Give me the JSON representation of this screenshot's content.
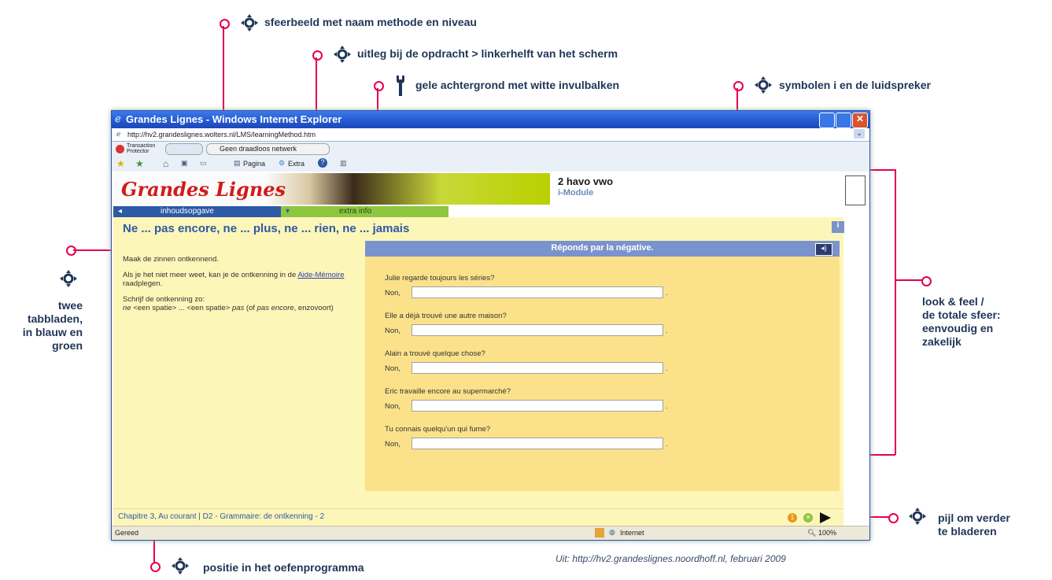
{
  "annotations": {
    "top1": "sfeerbeeld met naam methode en niveau",
    "top2": "uitleg bij de opdracht > linkerhelft van het scherm",
    "top3": "gele achtergrond met witte invulbalken",
    "top4": "symbolen i en de luidspreker",
    "left1": "twee",
    "left2": "tabbladen,",
    "left3": "in blauw en",
    "left4": "groen",
    "right1": "look & feel /",
    "right2": "de totale sfeer:",
    "right3": "eenvoudig en",
    "right4": "zakelijk",
    "arrow1": "pijl om verder",
    "arrow2": "te bladeren",
    "bottom": "positie in het oefenprogramma"
  },
  "caption": "Uit: http://hv2.grandeslignes.noordhoff.nl, februari 2009",
  "window": {
    "title": "Grandes Lignes - Windows Internet Explorer",
    "address": "http://hv2.grandeslignes.wolters.nl/LMS/learningMethod.htm",
    "transaction_protector": "Transaction Protector",
    "network": "Geen draadloos netwerk",
    "pagina": "Pagina",
    "extra": "Extra",
    "status_left": "Gereed",
    "zone": "Internet",
    "zoom": "100%"
  },
  "page": {
    "logo": "Grandes Lignes",
    "level": "2 havo vwo",
    "module": "i-Module",
    "tab_contents": "inhoudsopgave",
    "tab_extra": "extra info",
    "heading": "Ne ... pas encore, ne ... plus, ne ... rien, ne ... jamais",
    "info_icon": "i",
    "instructions": {
      "p1": "Maak de zinnen ontkennend.",
      "p2_pre": "Als je het niet meer weet, kan je de ontkenning in de ",
      "p2_link": "Aide-Mémoire",
      "p2_post": " raadplegen.",
      "p3_title": "Schrijf de ontkenning zo:",
      "p3_ne": "ne",
      "p3_mid": " <een spatie> ... <een spatie> ",
      "p3_pas": "pas",
      "p3_paren1": "  (of ",
      "p3_encore": "pas encore",
      "p3_paren2": ", enzovoort)"
    },
    "exercise_title": "Réponds par la négative.",
    "non_label": "Non,",
    "questions": [
      "Julie regarde toujours les séries?",
      "Elle a déjà trouvé une autre maison?",
      "Alain a trouvé quelque chose?",
      "Eric travaille encore au supermarché?",
      "Tu connais quelqu'un qui fume?"
    ],
    "breadcrumb": "Chapitre 3, Au courant | D2 - Grammaire: de ontkenning - 2",
    "badge_num": "1"
  },
  "colors": {
    "accent_pink": "#e4004f",
    "tab_blue": "#2d59a5",
    "tab_green": "#8dc63f",
    "content_yellow": "#fdf6b9",
    "exercise_yellow": "#fbe28a"
  }
}
